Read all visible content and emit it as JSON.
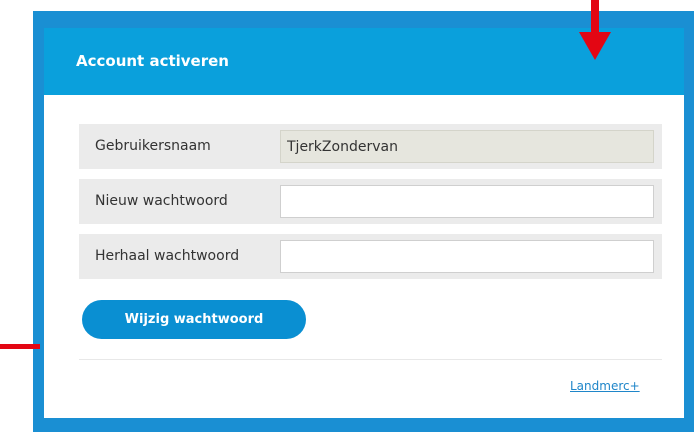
{
  "colors": {
    "accent": "#0aa0dc",
    "frame": "#1a8fd3",
    "button": "#0a8fd2",
    "link": "#1f86c9",
    "annotation": "#e30613"
  },
  "panel": {
    "title": "Account activeren"
  },
  "form": {
    "rows": [
      {
        "label": "Gebruikersnaam",
        "value": "TjerkZondervan",
        "readonly": true
      },
      {
        "label": "Nieuw wachtwoord",
        "value": "",
        "readonly": false
      },
      {
        "label": "Herhaal wachtwoord",
        "value": "",
        "readonly": false
      }
    ],
    "submit_label": "Wijzig wachtwoord"
  },
  "footer": {
    "link_label": "Landmerc+"
  },
  "annotations": {
    "arrow_icon": "red-arrow-down-icon",
    "line_icon": "red-line-marker"
  }
}
